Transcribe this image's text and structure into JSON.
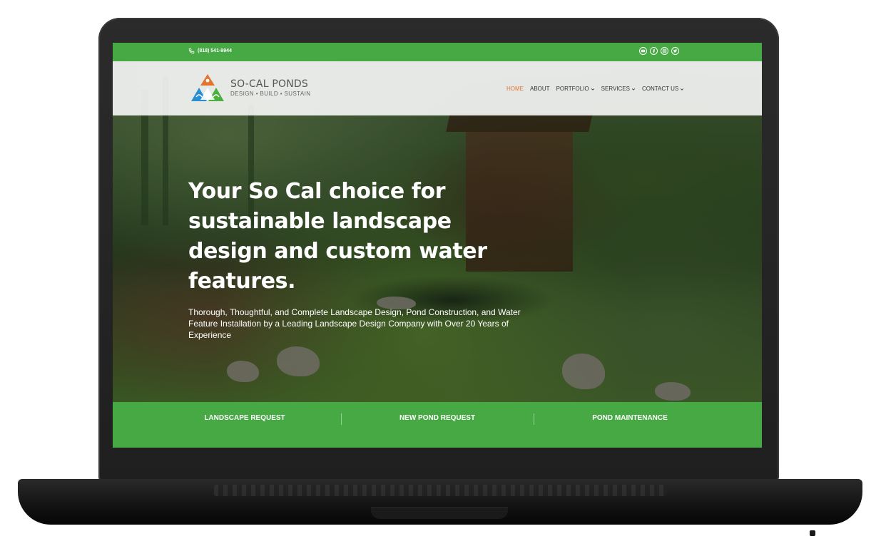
{
  "topbar": {
    "phone": "(818) 541-9944",
    "phone_icon": "phone-icon",
    "social_icons": [
      "youtube-icon",
      "facebook-icon",
      "instagram-icon",
      "twitter-icon"
    ]
  },
  "brand": {
    "name": "SO-CAL PONDS",
    "tagline": "DESIGN • BUILD • SUSTAIN",
    "logo_icon": "triangle-logo-icon"
  },
  "nav": {
    "items": [
      {
        "label": "HOME",
        "active": true,
        "dropdown": false
      },
      {
        "label": "ABOUT",
        "active": false,
        "dropdown": false
      },
      {
        "label": "PORTFOLIO",
        "active": false,
        "dropdown": true
      },
      {
        "label": "SERVICES",
        "active": false,
        "dropdown": true
      },
      {
        "label": "CONTACT US",
        "active": false,
        "dropdown": true
      }
    ]
  },
  "hero": {
    "title": "Your So Cal choice for sustainable landscape design and custom water features.",
    "subtitle": "Thorough, Thoughtful, and Complete Landscape Design, Pond Construction, and Water Feature Installation by a Leading Landscape Design Company with Over 20 Years of Experience"
  },
  "cta": {
    "items": [
      "LANDSCAPE REQUEST",
      "NEW POND REQUEST",
      "POND MAINTENANCE"
    ]
  },
  "colors": {
    "brand_green": "#47a944",
    "active_nav": "#e2742f",
    "logo_orange": "#e2742f",
    "logo_blue": "#2a8fd0",
    "logo_green": "#4caf3f"
  }
}
